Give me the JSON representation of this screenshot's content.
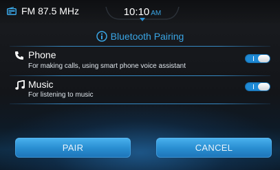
{
  "status_bar": {
    "radio_icon": "radio-icon",
    "radio": "FM 87.5 MHz",
    "time": "10:10",
    "ampm": "AM"
  },
  "dialog": {
    "title_icon": "info-icon",
    "title": "Bluetooth Pairing",
    "options": [
      {
        "icon": "phone-icon",
        "name": "Phone",
        "description": "For making calls, using smart phone voice assistant",
        "enabled": true
      },
      {
        "icon": "music-note-icon",
        "name": "Music",
        "description": "For listening to music",
        "enabled": true
      }
    ],
    "buttons": {
      "pair": "PAIR",
      "cancel": "CANCEL"
    }
  },
  "colors": {
    "accent": "#3aa6e6",
    "button": "#2a8fd2",
    "background": "#151719"
  }
}
